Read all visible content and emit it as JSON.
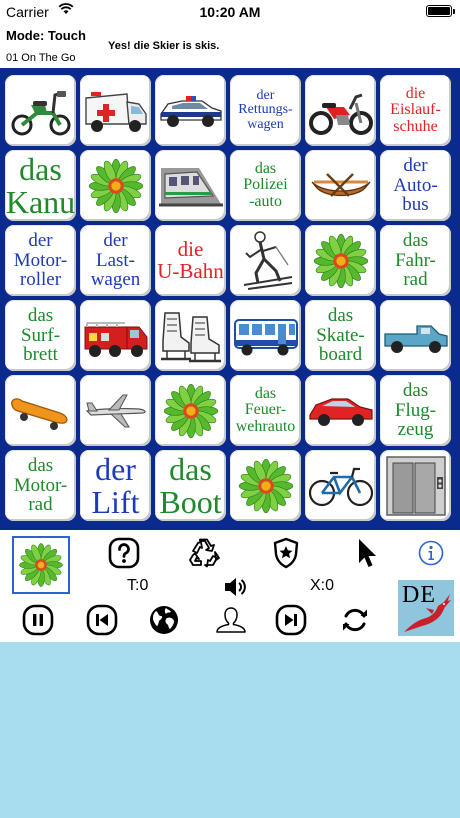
{
  "status_bar": {
    "carrier": "Carrier",
    "time": "10:20 AM"
  },
  "header": {
    "mode": "Mode:  Touch",
    "message": "Yes! die Skier is skis.",
    "lesson": "01 On The Go"
  },
  "board": {
    "tiles": [
      {
        "icon": "moped-icon"
      },
      {
        "icon": "ambulance-icon"
      },
      {
        "icon": "police-car-icon"
      },
      {
        "text": "der\nRettungs-\nwagen",
        "color": "blue"
      },
      {
        "icon": "motorcycle-icon"
      },
      {
        "text": "die\nEislauf-\nschuhe",
        "color": "red"
      },
      {
        "text": "das\nKanu",
        "color": "green"
      },
      {
        "icon": "flower-icon"
      },
      {
        "icon": "subway-train-icon"
      },
      {
        "text": "das\nPolizei\n-auto",
        "color": "green"
      },
      {
        "icon": "rowboat-icon"
      },
      {
        "text": "der\nAuto-\nbus",
        "color": "blue"
      },
      {
        "text": "der\nMotor-\nroller",
        "color": "blue"
      },
      {
        "text": "der\nLast-\nwagen",
        "color": "blue"
      },
      {
        "text": "die\nU-Bahn",
        "color": "red"
      },
      {
        "icon": "skier-icon"
      },
      {
        "icon": "flower-icon"
      },
      {
        "text": "das\nFahr-\nrad",
        "color": "green"
      },
      {
        "text": "das\nSurf-\nbrett",
        "color": "green"
      },
      {
        "icon": "fire-truck-icon"
      },
      {
        "icon": "ice-skates-icon"
      },
      {
        "icon": "bus-icon"
      },
      {
        "text": "das\nSkate-\nboard",
        "color": "green"
      },
      {
        "icon": "pickup-truck-icon"
      },
      {
        "icon": "skateboard-icon"
      },
      {
        "icon": "airplane-icon"
      },
      {
        "icon": "flower-icon"
      },
      {
        "text": "das\nFeuer-\nwehrauto",
        "color": "green"
      },
      {
        "icon": "red-car-icon"
      },
      {
        "text": "das\nFlug-\nzeug",
        "color": "green"
      },
      {
        "text": "das\nMotor-\nrad",
        "color": "green"
      },
      {
        "text": "der\nLift",
        "color": "blue"
      },
      {
        "text": "das\nBoot",
        "color": "green"
      },
      {
        "icon": "flower-icon"
      },
      {
        "icon": "bicycle-icon"
      },
      {
        "icon": "elevator-icon"
      }
    ]
  },
  "controls": {
    "timer": "T:0",
    "score": "X:0",
    "badge": "DE",
    "icons": {
      "help": "question-icon",
      "recycle": "recycle-icon",
      "badge": "shield-star-icon",
      "pointer": "cursor-arrow-icon",
      "info": "info-icon",
      "sound": "speaker-icon",
      "pause": "pause-icon",
      "previous": "skip-back-icon",
      "globe": "globe-icon",
      "user": "user-icon",
      "next": "skip-forward-icon",
      "refresh": "refresh-icon"
    }
  },
  "colors": {
    "board_background": "#0a2a8e",
    "page_background": "#a8dcef",
    "green_word": "#1e8a2a",
    "blue_word": "#1f3ab8",
    "red_word": "#e02424",
    "info_blue": "#2b63d6"
  }
}
